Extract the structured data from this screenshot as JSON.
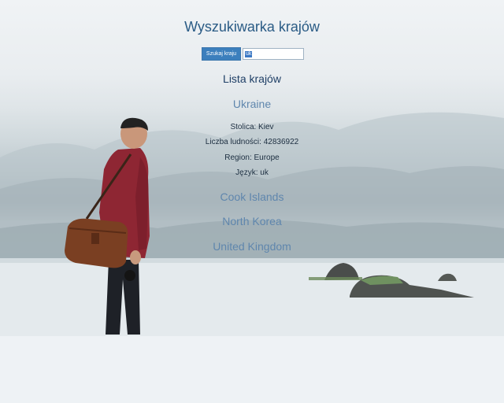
{
  "page": {
    "title": "Wyszukiwarka krajów",
    "list_title": "Lista krajów"
  },
  "search": {
    "button_label": "Szukaj kraju",
    "input_value": "uk"
  },
  "countries": [
    {
      "name": "Ukraine",
      "expanded": true,
      "details": {
        "capital": "Stolica: Kiev",
        "population": "Liczba ludności: 42836922",
        "region": "Region: Europe",
        "language": "Język: uk"
      }
    },
    {
      "name": "Cook Islands",
      "expanded": false
    },
    {
      "name": "North Korea",
      "expanded": false
    },
    {
      "name": "United Kingdom",
      "expanded": false
    }
  ],
  "colors": {
    "title": "#2a5b85",
    "list_title": "#1f3f66",
    "country_link": "#5f86ad",
    "button_bg": "#3c7fbd"
  },
  "background": {
    "subject": "man-with-leather-bag-looking-at-misty-lake-photo"
  }
}
